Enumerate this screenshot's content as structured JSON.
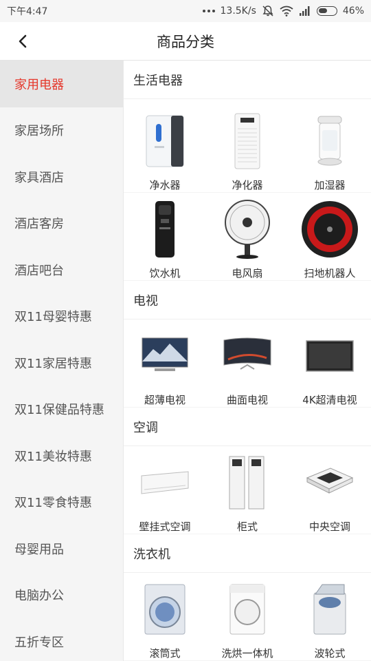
{
  "status_bar": {
    "time": "下午4:47",
    "net_speed": "13.5K/s",
    "battery": "46%"
  },
  "header": {
    "title": "商品分类"
  },
  "sidebar": {
    "items": [
      {
        "label": "家用电器"
      },
      {
        "label": "家居场所"
      },
      {
        "label": "家具酒店"
      },
      {
        "label": "酒店客房"
      },
      {
        "label": "酒店吧台"
      },
      {
        "label": "双11母婴特惠"
      },
      {
        "label": "双11家居特惠"
      },
      {
        "label": "双11保健品特惠"
      },
      {
        "label": "双11美妆特惠"
      },
      {
        "label": "双11零食特惠"
      },
      {
        "label": "母婴用品"
      },
      {
        "label": "电脑办公"
      },
      {
        "label": "五折专区"
      }
    ]
  },
  "sections": [
    {
      "title": "生活电器",
      "products": [
        {
          "label": "净水器",
          "icon": "water-purifier-icon"
        },
        {
          "label": "净化器",
          "icon": "air-purifier-icon"
        },
        {
          "label": "加湿器",
          "icon": "humidifier-icon"
        },
        {
          "label": "饮水机",
          "icon": "water-dispenser-icon"
        },
        {
          "label": "电风扇",
          "icon": "fan-icon"
        },
        {
          "label": "扫地机器人",
          "icon": "robot-vacuum-icon"
        }
      ]
    },
    {
      "title": "电视",
      "products": [
        {
          "label": "超薄电视",
          "icon": "slim-tv-icon"
        },
        {
          "label": "曲面电视",
          "icon": "curved-tv-icon"
        },
        {
          "label": "4K超清电视",
          "icon": "4k-tv-icon"
        }
      ]
    },
    {
      "title": "空调",
      "products": [
        {
          "label": "壁挂式空调",
          "icon": "wall-ac-icon"
        },
        {
          "label": "柜式",
          "icon": "cabinet-ac-icon"
        },
        {
          "label": "中央空调",
          "icon": "central-ac-icon"
        }
      ]
    },
    {
      "title": "洗衣机",
      "products": [
        {
          "label": "滚筒式",
          "icon": "front-load-washer-icon"
        },
        {
          "label": "洗烘一体机",
          "icon": "washer-dryer-icon"
        },
        {
          "label": "波轮式",
          "icon": "top-load-washer-icon"
        }
      ]
    }
  ],
  "colors": {
    "accent": "#e5372b",
    "sidebar_bg": "#f5f5f5",
    "sidebar_active_bg": "#e6e6e6"
  }
}
